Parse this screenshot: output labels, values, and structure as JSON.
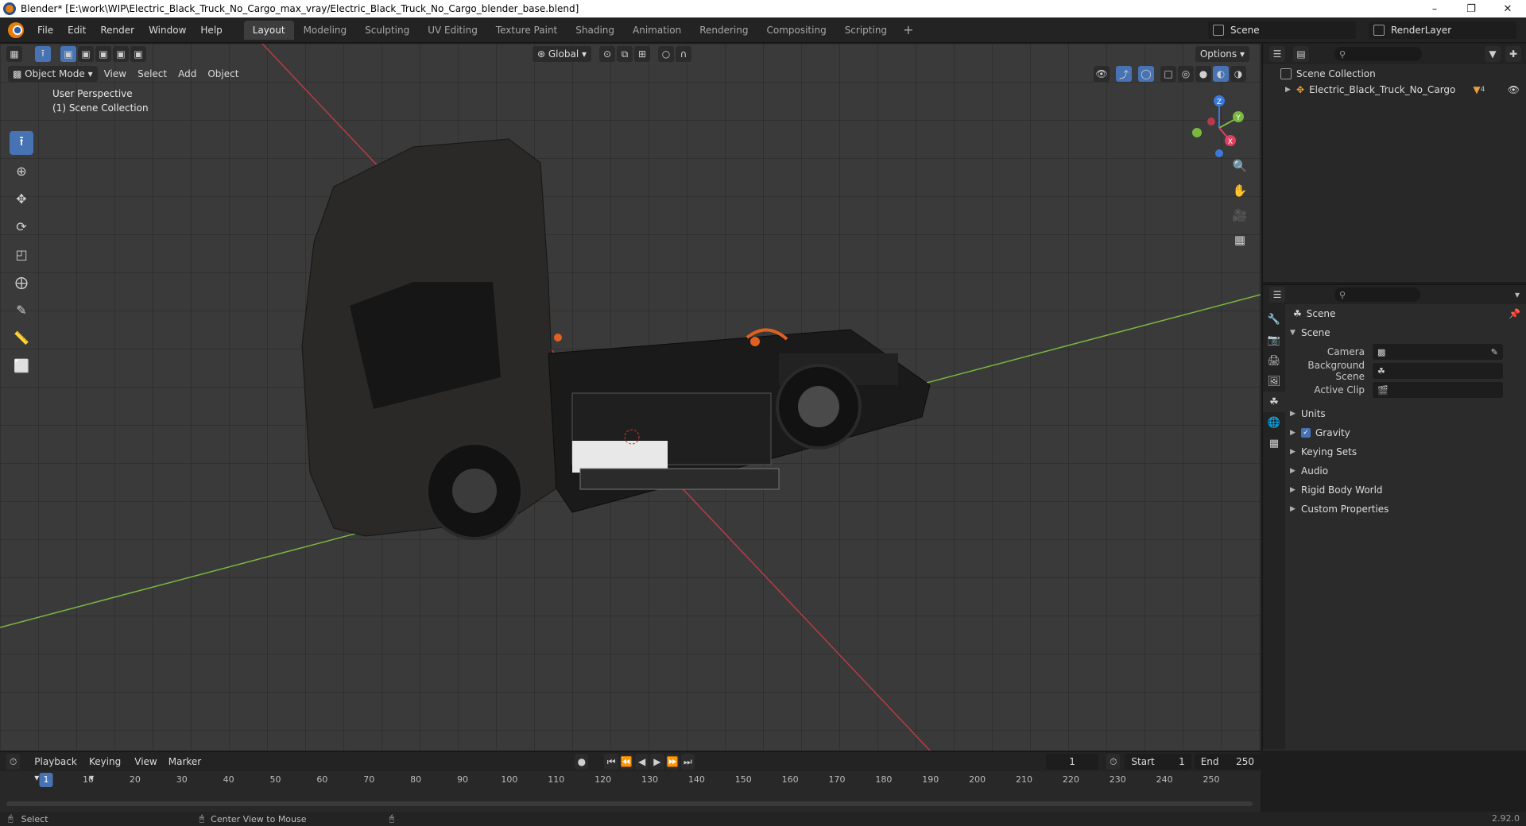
{
  "window": {
    "title": "Blender* [E:\\work\\WIP\\Electric_Black_Truck_No_Cargo_max_vray/Electric_Black_Truck_No_Cargo_blender_base.blend]"
  },
  "menus": [
    "File",
    "Edit",
    "Render",
    "Window",
    "Help"
  ],
  "workspaces": [
    "Layout",
    "Modeling",
    "Sculpting",
    "UV Editing",
    "Texture Paint",
    "Shading",
    "Animation",
    "Rendering",
    "Compositing",
    "Scripting"
  ],
  "active_workspace": "Layout",
  "scene_name": "Scene",
  "render_layer": "RenderLayer",
  "viewport": {
    "mode": "Object Mode",
    "menus": [
      "View",
      "Select",
      "Add",
      "Object"
    ],
    "transform_orientation": "Global",
    "options_label": "Options",
    "info_line1": "User Perspective",
    "info_line2": "(1) Scene Collection",
    "gizmo_axes": {
      "x": "X",
      "y": "Y",
      "z": "Z"
    }
  },
  "outliner": {
    "root": "Scene Collection",
    "object": "Electric_Black_Truck_No_Cargo",
    "object_badge": "4"
  },
  "properties": {
    "context_label": "Scene",
    "panel_title": "Scene",
    "fields": {
      "camera_label": "Camera",
      "background_label": "Background Scene",
      "clip_label": "Active Clip"
    },
    "panels": {
      "units": "Units",
      "gravity": "Gravity",
      "keying_sets": "Keying Sets",
      "audio": "Audio",
      "rigid_body": "Rigid Body World",
      "custom_props": "Custom Properties"
    }
  },
  "timeline": {
    "menus": [
      "Playback",
      "Keying",
      "View",
      "Marker"
    ],
    "current_frame": "1",
    "start_label": "Start",
    "start_value": "1",
    "end_label": "End",
    "end_value": "250",
    "ticks": [
      "1",
      "10",
      "20",
      "30",
      "40",
      "50",
      "60",
      "70",
      "80",
      "90",
      "100",
      "110",
      "120",
      "130",
      "140",
      "150",
      "160",
      "170",
      "180",
      "190",
      "200",
      "210",
      "220",
      "230",
      "240",
      "250"
    ]
  },
  "statusbar": {
    "left_action": "Select",
    "middle_action": "Center View to Mouse",
    "version": "2.92.0"
  },
  "colors": {
    "accent": "#4772b3",
    "axis_x": "#e04060",
    "axis_y": "#7ab840",
    "axis_z": "#3c78d8"
  }
}
